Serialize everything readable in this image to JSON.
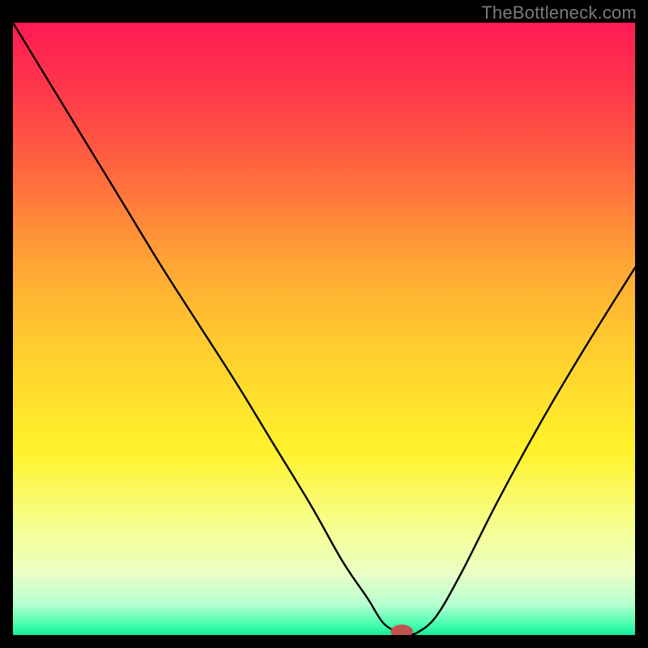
{
  "watermark": "TheBottleneck.com",
  "chart_data": {
    "type": "line",
    "title": "",
    "xlabel": "",
    "ylabel": "",
    "xlim": [
      0,
      100
    ],
    "ylim": [
      0,
      100
    ],
    "background_gradient": {
      "stops": [
        {
          "pos": 0.0,
          "color": "#ff1a53"
        },
        {
          "pos": 0.12,
          "color": "#ff3b4a"
        },
        {
          "pos": 0.25,
          "color": "#ff6a3e"
        },
        {
          "pos": 0.4,
          "color": "#ffa834"
        },
        {
          "pos": 0.55,
          "color": "#ffd22e"
        },
        {
          "pos": 0.7,
          "color": "#fff22b"
        },
        {
          "pos": 0.82,
          "color": "#f6ff8e"
        },
        {
          "pos": 0.9,
          "color": "#eaffc6"
        },
        {
          "pos": 0.95,
          "color": "#b6ffd0"
        },
        {
          "pos": 0.985,
          "color": "#3fffad"
        },
        {
          "pos": 1.0,
          "color": "#17e89b"
        }
      ]
    },
    "series": [
      {
        "name": "bottleneck-curve",
        "color": "#000000",
        "width": 2.4,
        "x": [
          0,
          6,
          12,
          18,
          24,
          30,
          36,
          42,
          48,
          53,
          57,
          59.5,
          62,
          63.5,
          65,
          68,
          72,
          78,
          85,
          92,
          100
        ],
        "values": [
          100,
          90,
          80,
          70,
          60,
          50.5,
          41,
          31,
          21,
          12,
          6,
          2,
          0.4,
          0.2,
          0.4,
          3,
          10,
          22,
          35,
          47,
          60
        ]
      }
    ],
    "marker": {
      "name": "optimal-point",
      "x": 62.5,
      "y": 0.6,
      "rx": 1.8,
      "ry": 1.1,
      "color": "#c0534e"
    }
  }
}
